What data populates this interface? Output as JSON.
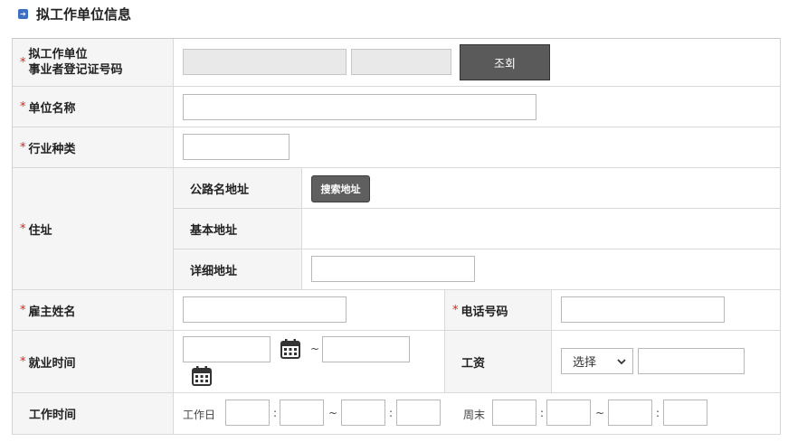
{
  "section": {
    "title": "拟工作单位信息"
  },
  "required_mark": "*",
  "rows": {
    "reg_no": {
      "label_line1": "拟工作单位",
      "label_line2": "事业者登记证号码",
      "search_button": "조회"
    },
    "company_name": {
      "label": "单位名称"
    },
    "industry": {
      "label": "行业种类"
    },
    "address": {
      "label": "住址",
      "road_label": "公路名地址",
      "search_address_button": "搜索地址",
      "basic_label": "基本地址",
      "detail_label": "详细地址"
    },
    "employer_name": {
      "label": "雇主姓名"
    },
    "phone": {
      "label": "电话号码"
    },
    "employment_period": {
      "label": "就业时间",
      "tilde": "~"
    },
    "wage": {
      "label": "工资",
      "select_value": "选择"
    },
    "work_hours": {
      "label": "工作时间",
      "weekday_label": "工作日",
      "weekend_label": "周末",
      "colon": ":",
      "tilde": "~"
    }
  },
  "icons": {
    "section": "arrow-right-icon",
    "calendar": "calendar-icon",
    "dropdown": "chevron-down-icon"
  },
  "colors": {
    "required": "#d9241c",
    "label_bg": "#f5f5f5",
    "button_dark": "#5a5a5a",
    "title_icon": "#3a6fc4"
  }
}
